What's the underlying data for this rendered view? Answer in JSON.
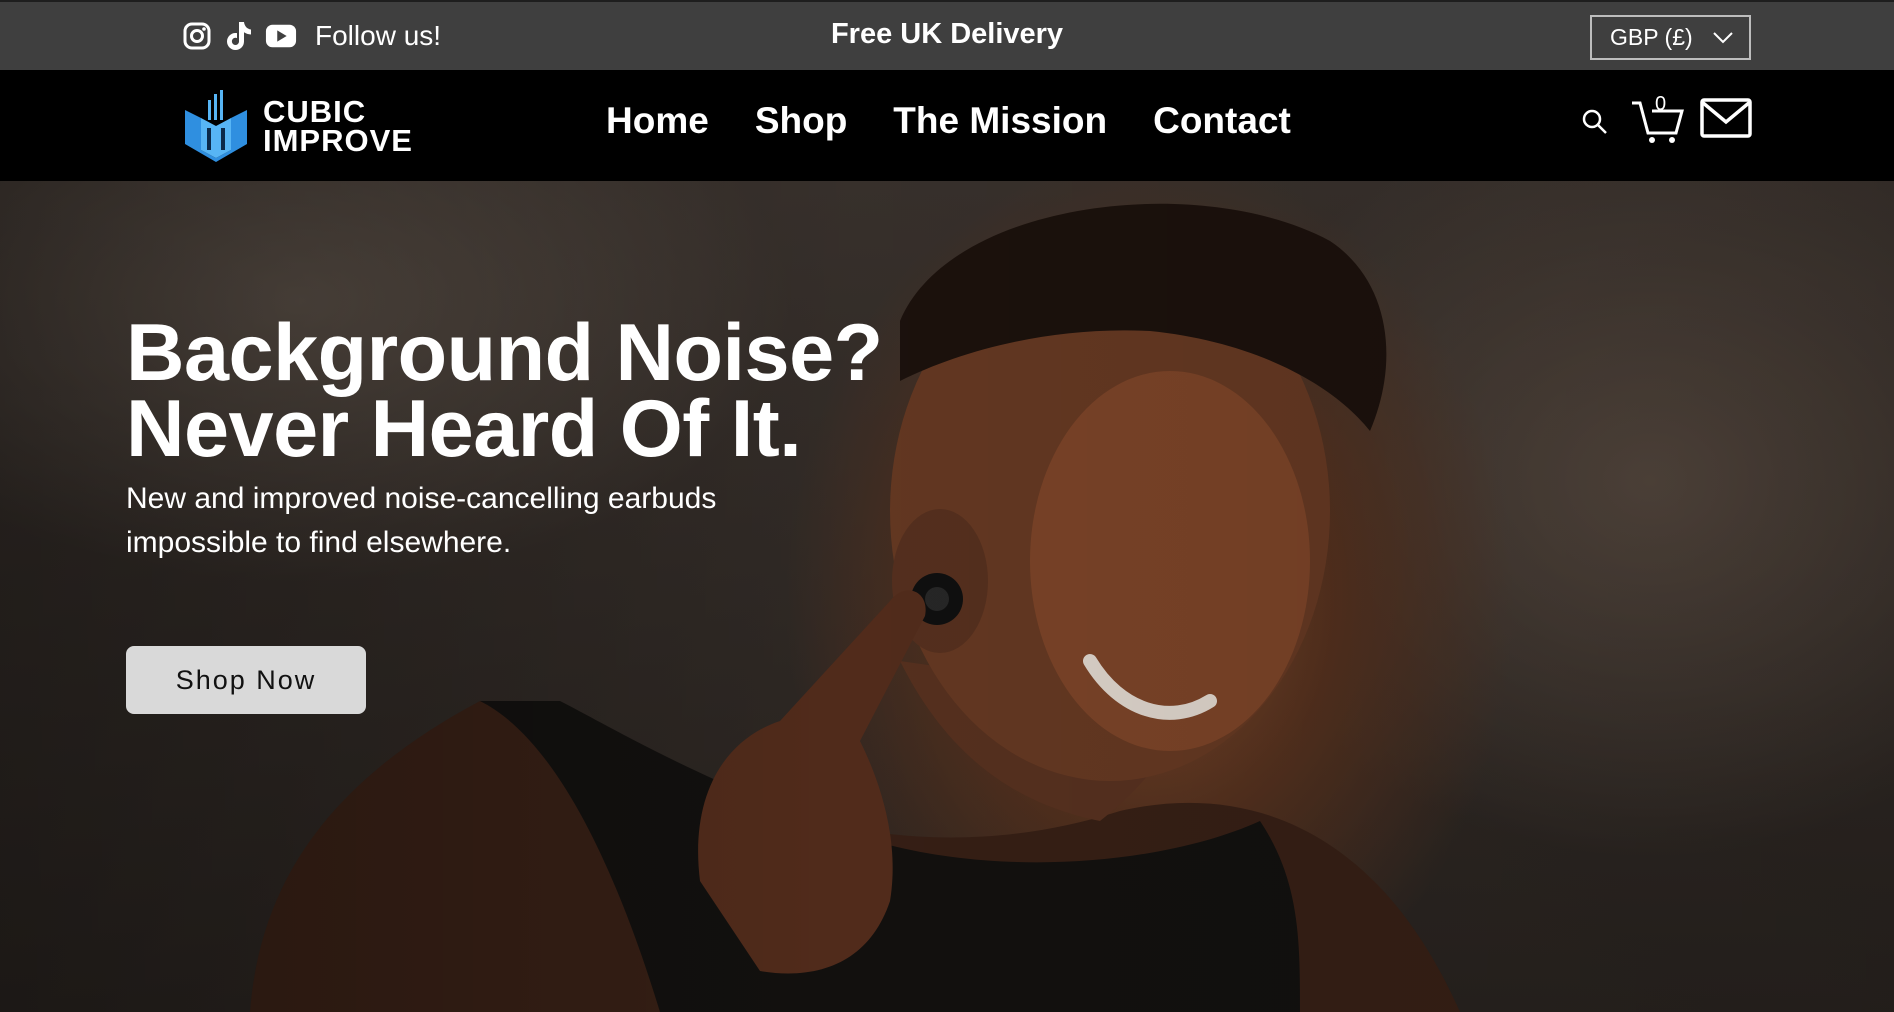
{
  "topbar": {
    "social_icons": [
      "instagram-icon",
      "tiktok-icon",
      "youtube-icon"
    ],
    "follow_text": "Follow us!",
    "delivery_text": "Free UK Delivery",
    "currency": "GBP (£)"
  },
  "header": {
    "logo": {
      "line1": "CUBIC",
      "line2": "IMPROVE"
    },
    "nav": [
      "Home",
      "Shop",
      "The Mission",
      "Contact"
    ],
    "cart_count": "0"
  },
  "hero": {
    "headline_line1": "Background Noise?",
    "headline_line2": "Never Heard Of It.",
    "subline_line1": "New and improved noise-cancelling earbuds",
    "subline_line2": "impossible to find elsewhere.",
    "cta": "Shop Now"
  },
  "colors": {
    "topbar_bg": "#3f3f3f",
    "header_bg": "#000000",
    "logo_blue": "#2f8fe0",
    "cta_bg": "#d9d9d9"
  }
}
